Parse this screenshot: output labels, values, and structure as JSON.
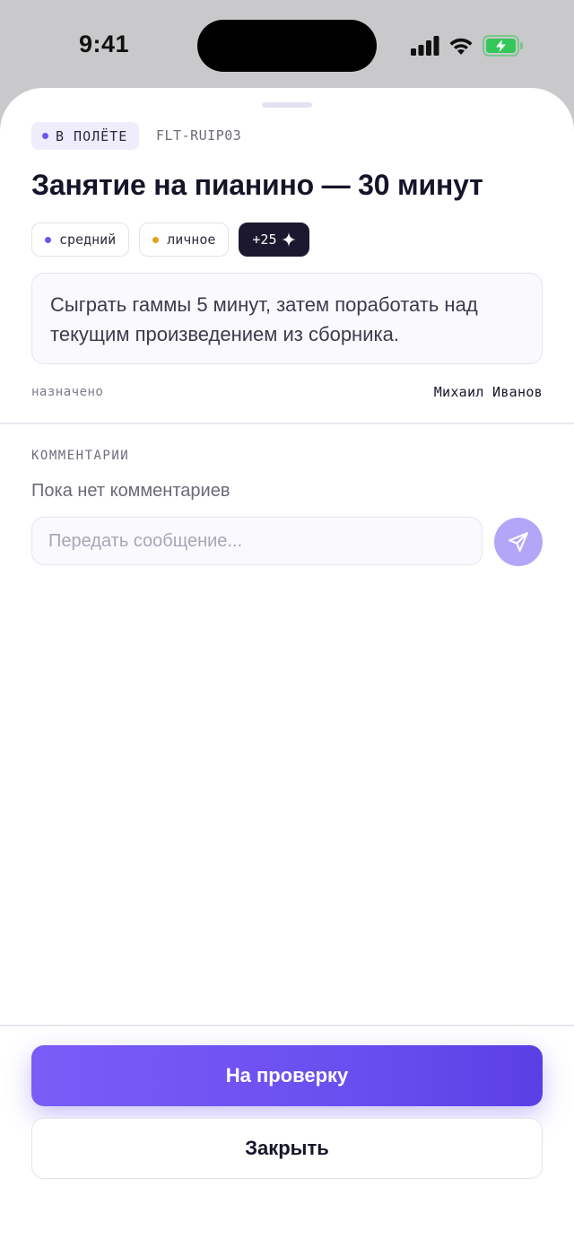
{
  "status_bar": {
    "time": "9:41"
  },
  "task": {
    "status_label": "В ПОЛЁТЕ",
    "status_color": "#6c55f0",
    "id": "FLT-RUIP03",
    "title": "Занятие на пианино — 30 минут",
    "tags": [
      {
        "label": "средний",
        "dot_color": "#6c55f0"
      },
      {
        "label": "личное",
        "dot_color": "#e0a21e"
      }
    ],
    "reward": {
      "label": "+25",
      "icon": "sparkle-icon"
    },
    "description": "Сыграть гаммы 5 минут, затем поработать над текущим произведением из сборника.",
    "assigned_label": "назначено",
    "assignee": "Михаил Иванов"
  },
  "comments": {
    "section_label": "КОММЕНТАРИИ",
    "empty_text": "Пока нет комментариев",
    "input_placeholder": "Передать сообщение...",
    "input_value": "",
    "send_icon": "send-icon"
  },
  "actions": {
    "primary_label": "На проверку",
    "secondary_label": "Закрыть",
    "accent_color": "#6a4ff0"
  }
}
